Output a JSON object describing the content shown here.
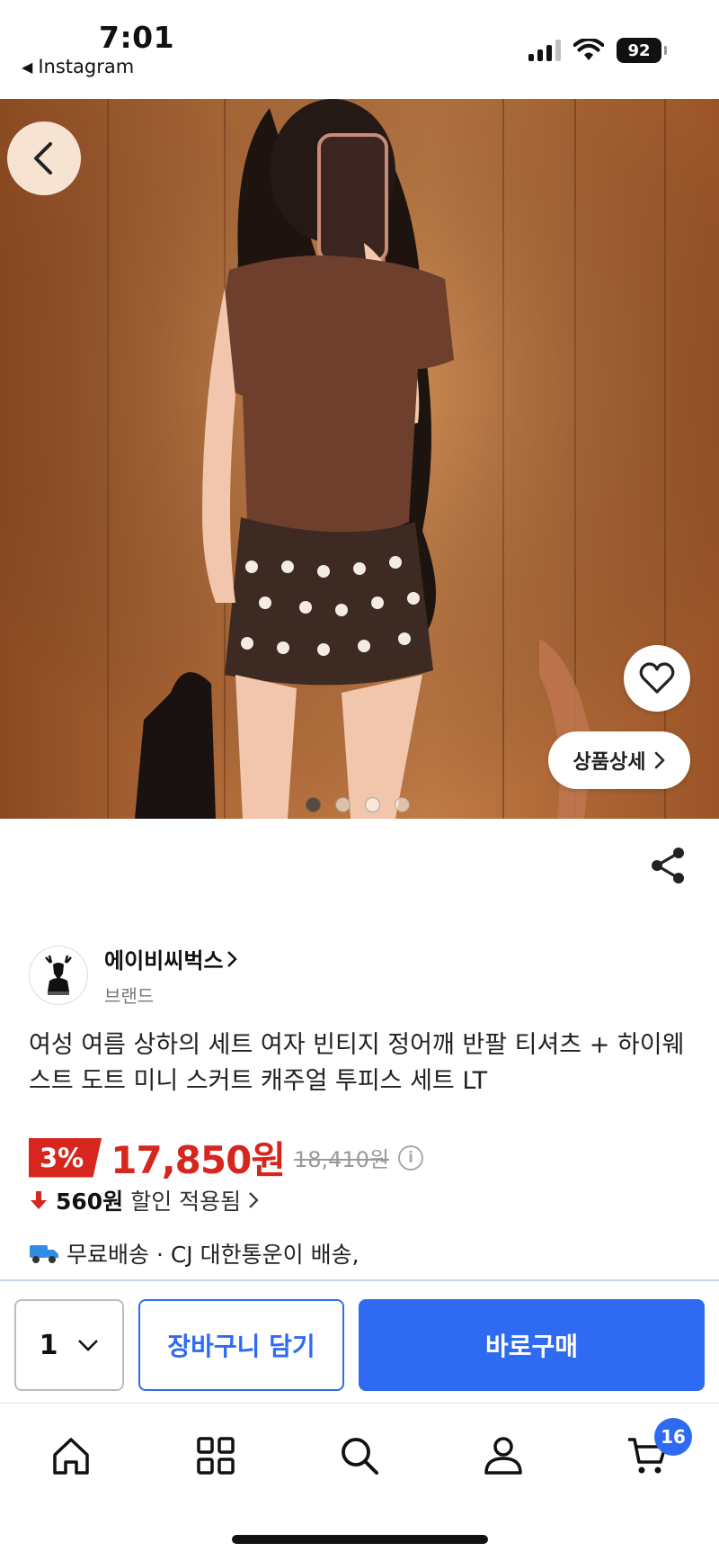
{
  "status_bar": {
    "time": "7:01",
    "back_app_label": "Instagram",
    "battery": "92",
    "icons": [
      "signal-icon",
      "wifi-icon",
      "battery-icon"
    ]
  },
  "gallery": {
    "image_count": 4,
    "active_index": 0,
    "detail_button_label": "상품상세",
    "icons": [
      "back-arrow-icon",
      "heart-icon",
      "chevron-right-icon"
    ]
  },
  "brand": {
    "name": "에이비씨벅스",
    "subtitle": "브랜드"
  },
  "product": {
    "title": "여성 여름 상하의 세트 여자 빈티지 정어깨 반팔 티셔츠 + 하이웨스트 도트 미니 스커트 캐주얼 투피스 세트 LT",
    "discount": "3%",
    "price": "17,850원",
    "original_price": "18,410원",
    "saving_amount": "560원",
    "saving_text": "할인 적용됨",
    "shipping_text": "무료배송 · CJ 대한통운이 배송,"
  },
  "purchase_bar": {
    "quantity": "1",
    "cart_label": "장바구니 담기",
    "buy_label": "바로구매"
  },
  "tab_bar": {
    "tabs": [
      "home-icon",
      "categories-icon",
      "search-icon",
      "profile-icon",
      "cart-icon"
    ],
    "cart_badge": "16"
  },
  "colors": {
    "accent_blue": "#2f6bf2",
    "sale_red": "#d6261d"
  }
}
